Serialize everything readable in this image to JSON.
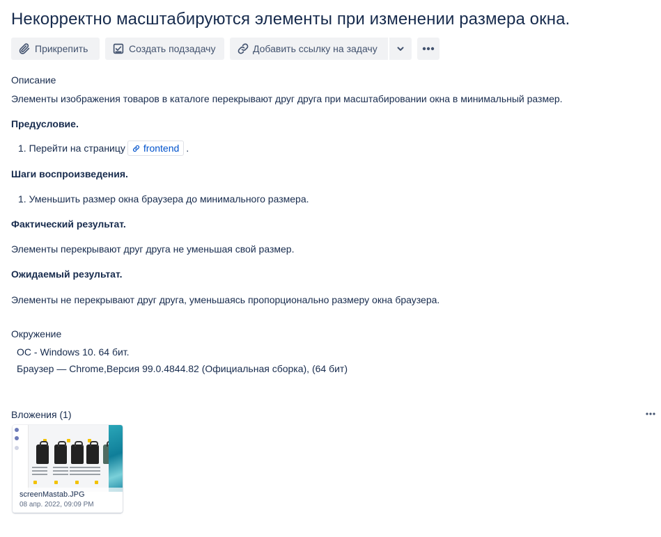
{
  "issue": {
    "title": "Некорректно масштабируются элементы при изменении размера окна."
  },
  "toolbar": {
    "attach_label": "Прикрепить",
    "subtask_label": "Создать подзадачу",
    "link_label": "Добавить ссылку на задачу",
    "caret_icon": "chevron-down-icon",
    "more_icon": "more-horizontal-icon"
  },
  "description": {
    "heading": "Описание",
    "text": "Элементы изображения товаров в каталоге перекрывают друг друга при масштабировании окна в минимальный размер.",
    "precondition_heading": "Предусловие.",
    "precondition_item": "1. Перейти на страницу",
    "precondition_link": "frontend",
    "precondition_suffix": ".",
    "steps_heading": "Шаги воспроизведения.",
    "steps_item": "1. Уменьшить размер окна браузера до минимального размера.",
    "actual_heading": "Фактический результат.",
    "actual_text": "Элементы перекрывают друг друга не уменьшая свой размер.",
    "expected_heading": "Ожидаемый результат.",
    "expected_text": "Элементы не перекрывают друг друга, уменьшаясь пропорционально размеру окна браузера."
  },
  "environment": {
    "heading": "Окружение",
    "lines": [
      "ОС - Windows 10. 64 бит.",
      "Браузер — Chrome,Версия 99.0.4844.82 (Официальная сборка), (64 бит)"
    ]
  },
  "attachments": {
    "heading": "Вложения (1)",
    "items": [
      {
        "filename": "screenMastab.JPG",
        "date": "08 апр. 2022, 09:09 PM"
      }
    ]
  },
  "colors": {
    "text": "#172b4d",
    "button_bg": "#f1f2f4",
    "button_text": "#42526e",
    "link": "#0052cc"
  }
}
